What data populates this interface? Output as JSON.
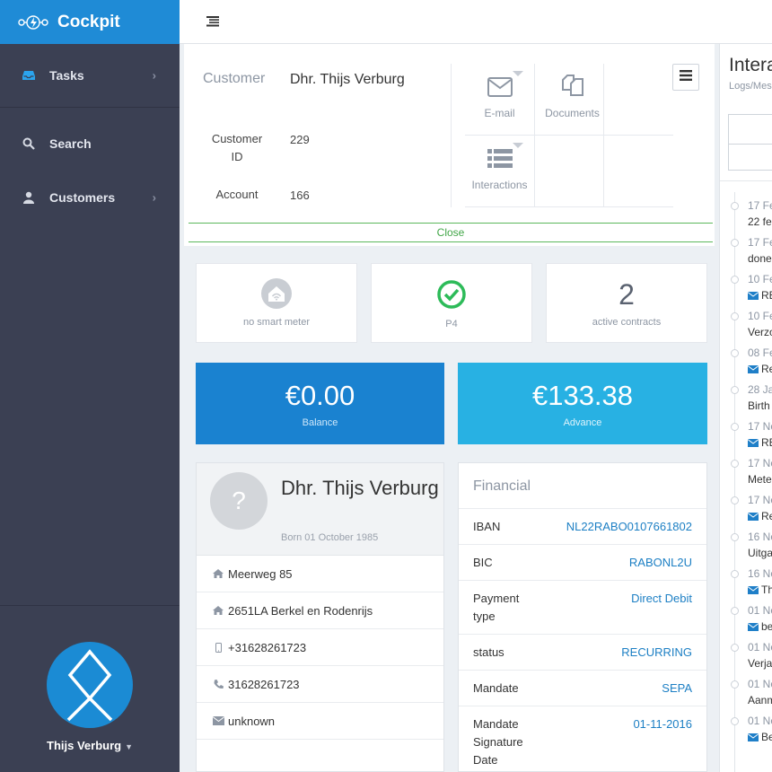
{
  "app": {
    "title": "Cockpit"
  },
  "sidebar": {
    "items": [
      {
        "label": "Tasks",
        "icon": "inbox-icon",
        "has_children": true
      },
      {
        "label": "Search",
        "icon": "search-icon",
        "has_children": false
      },
      {
        "label": "Customers",
        "icon": "user-icon",
        "has_children": true
      }
    ],
    "user": {
      "name": "Thijs Verburg"
    }
  },
  "customer": {
    "heading_label": "Customer",
    "name": "Dhr. Thijs Verburg",
    "customer_id_label": "Customer ID",
    "customer_id": "229",
    "account_label": "Account",
    "account": "166",
    "actions": [
      {
        "label": "E-mail",
        "icon": "envelope-icon",
        "has_dropdown": true
      },
      {
        "label": "Documents",
        "icon": "documents-icon",
        "has_dropdown": false
      },
      {
        "label": "Interactions",
        "icon": "list-icon",
        "has_dropdown": true
      }
    ],
    "close_label": "Close"
  },
  "stats": {
    "smart_meter": {
      "label": "no smart meter",
      "icon": "house-wifi-icon"
    },
    "p4": {
      "label": "P4",
      "icon": "check-circle-icon"
    },
    "contracts": {
      "value": "2",
      "label": "active contracts"
    }
  },
  "balance": {
    "balance": {
      "amount": "€0.00",
      "label": "Balance",
      "color": "#1a82d0"
    },
    "advance": {
      "amount": "€133.38",
      "label": "Advance",
      "color": "#28b1e3"
    }
  },
  "profile": {
    "avatar": "?",
    "name": "Dhr. Thijs Verburg",
    "born": "Born 01 October 1985",
    "rows": [
      {
        "icon": "home-icon",
        "text": "Meerweg 85"
      },
      {
        "icon": "home-icon",
        "text": "2651LA Berkel en Rodenrijs"
      },
      {
        "icon": "mobile-icon",
        "text": "+31628261723"
      },
      {
        "icon": "phone-icon",
        "text": "31628261723"
      },
      {
        "icon": "envelope-icon",
        "text": "unknown"
      }
    ]
  },
  "financial": {
    "title": "Financial",
    "rows": [
      {
        "key": "IBAN",
        "value": "NL22RABO0107661802"
      },
      {
        "key": "BIC",
        "value": "RABONL2U"
      },
      {
        "key": "Payment type",
        "value": "Direct Debit"
      },
      {
        "key": "status",
        "value": "RECURRING"
      },
      {
        "key": "Mandate",
        "value": "SEPA"
      },
      {
        "key": "Mandate Signature Date",
        "value": "01-11-2016"
      }
    ]
  },
  "interactions": {
    "title": "Intera",
    "subtitle": "Logs/Mes",
    "items": [
      {
        "date": "17 Fe",
        "text": "22 fe",
        "mail": false
      },
      {
        "date": "17 Fe",
        "text": "done",
        "mail": false
      },
      {
        "date": "10 Fe",
        "text": "RE",
        "mail": true
      },
      {
        "date": "10 Fe",
        "text": "Verzo",
        "mail": false
      },
      {
        "date": "08 Fe",
        "text": "Re",
        "mail": true
      },
      {
        "date": "28 Ja",
        "text": "Birth",
        "mail": false
      },
      {
        "date": "17 No",
        "text": "RE",
        "mail": true
      },
      {
        "date": "17 No",
        "text": "Mete",
        "mail": false
      },
      {
        "date": "17 No",
        "text": "Re",
        "mail": true
      },
      {
        "date": "16 No",
        "text": "Uitga",
        "mail": false
      },
      {
        "date": "16 No",
        "text": "Th",
        "mail": true
      },
      {
        "date": "01 No",
        "text": "be",
        "mail": true
      },
      {
        "date": "01 No",
        "text": "Verja",
        "mail": false
      },
      {
        "date": "01 No",
        "text": "Aanm",
        "mail": false
      },
      {
        "date": "01 No",
        "text": "Be",
        "mail": true
      }
    ]
  }
}
